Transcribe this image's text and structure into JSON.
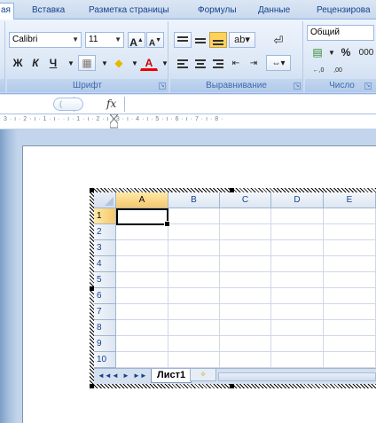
{
  "tabs": [
    {
      "label": "ая",
      "active": true
    },
    {
      "label": "Вставка"
    },
    {
      "label": "Разметка страницы"
    },
    {
      "label": "Формулы"
    },
    {
      "label": "Данные"
    },
    {
      "label": "Рецензирова"
    }
  ],
  "font_group": {
    "label": "Шрифт",
    "font_name": "Calibri",
    "font_size": "11",
    "grow": "A",
    "shrink": "A",
    "bold": "Ж",
    "italic": "К",
    "underline": "Ч",
    "fill_glyph": "◆",
    "color_glyph": "A"
  },
  "align_group": {
    "label": "Выравнивание"
  },
  "number_group": {
    "label": "Число",
    "format": "Общий",
    "percent": "%",
    "thousands": "000",
    "inc_decimal": "←,0 ,00",
    "dec_decimal": ",00 →,0"
  },
  "formula_bar": {
    "fx": "fx",
    "name": ""
  },
  "ruler": {
    "marks": "3 · ı · 2 · ı · 1 · ı ·   · ı · 1 · ı · 2 · ı · 3 · ı · 4 · ı · 5 · ı · 6 · ı · 7 · ı · 8 ·"
  },
  "sheet": {
    "columns": [
      "A",
      "B",
      "C",
      "D",
      "E"
    ],
    "rows": [
      "1",
      "2",
      "3",
      "4",
      "5",
      "6",
      "7",
      "8",
      "9",
      "10"
    ],
    "active_tab": "Лист1",
    "nav": [
      "◄◄",
      "◄",
      "►",
      "►►"
    ]
  },
  "colors": {
    "accent": "#15428b",
    "ribbon": "#dde8f6",
    "selection": "#f7c76b"
  }
}
